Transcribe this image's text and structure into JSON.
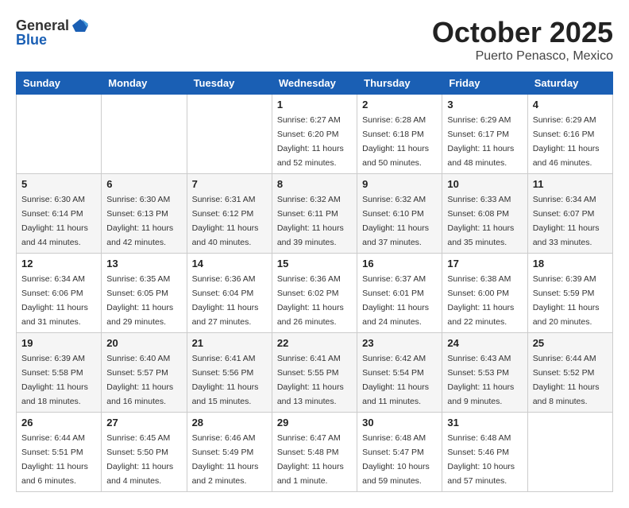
{
  "header": {
    "logo_general": "General",
    "logo_blue": "Blue",
    "month": "October 2025",
    "location": "Puerto Penasco, Mexico"
  },
  "weekdays": [
    "Sunday",
    "Monday",
    "Tuesday",
    "Wednesday",
    "Thursday",
    "Friday",
    "Saturday"
  ],
  "weeks": [
    [
      {
        "day": "",
        "sunrise": "",
        "sunset": "",
        "daylight": ""
      },
      {
        "day": "",
        "sunrise": "",
        "sunset": "",
        "daylight": ""
      },
      {
        "day": "",
        "sunrise": "",
        "sunset": "",
        "daylight": ""
      },
      {
        "day": "1",
        "sunrise": "Sunrise: 6:27 AM",
        "sunset": "Sunset: 6:20 PM",
        "daylight": "Daylight: 11 hours and 52 minutes."
      },
      {
        "day": "2",
        "sunrise": "Sunrise: 6:28 AM",
        "sunset": "Sunset: 6:18 PM",
        "daylight": "Daylight: 11 hours and 50 minutes."
      },
      {
        "day": "3",
        "sunrise": "Sunrise: 6:29 AM",
        "sunset": "Sunset: 6:17 PM",
        "daylight": "Daylight: 11 hours and 48 minutes."
      },
      {
        "day": "4",
        "sunrise": "Sunrise: 6:29 AM",
        "sunset": "Sunset: 6:16 PM",
        "daylight": "Daylight: 11 hours and 46 minutes."
      }
    ],
    [
      {
        "day": "5",
        "sunrise": "Sunrise: 6:30 AM",
        "sunset": "Sunset: 6:14 PM",
        "daylight": "Daylight: 11 hours and 44 minutes."
      },
      {
        "day": "6",
        "sunrise": "Sunrise: 6:30 AM",
        "sunset": "Sunset: 6:13 PM",
        "daylight": "Daylight: 11 hours and 42 minutes."
      },
      {
        "day": "7",
        "sunrise": "Sunrise: 6:31 AM",
        "sunset": "Sunset: 6:12 PM",
        "daylight": "Daylight: 11 hours and 40 minutes."
      },
      {
        "day": "8",
        "sunrise": "Sunrise: 6:32 AM",
        "sunset": "Sunset: 6:11 PM",
        "daylight": "Daylight: 11 hours and 39 minutes."
      },
      {
        "day": "9",
        "sunrise": "Sunrise: 6:32 AM",
        "sunset": "Sunset: 6:10 PM",
        "daylight": "Daylight: 11 hours and 37 minutes."
      },
      {
        "day": "10",
        "sunrise": "Sunrise: 6:33 AM",
        "sunset": "Sunset: 6:08 PM",
        "daylight": "Daylight: 11 hours and 35 minutes."
      },
      {
        "day": "11",
        "sunrise": "Sunrise: 6:34 AM",
        "sunset": "Sunset: 6:07 PM",
        "daylight": "Daylight: 11 hours and 33 minutes."
      }
    ],
    [
      {
        "day": "12",
        "sunrise": "Sunrise: 6:34 AM",
        "sunset": "Sunset: 6:06 PM",
        "daylight": "Daylight: 11 hours and 31 minutes."
      },
      {
        "day": "13",
        "sunrise": "Sunrise: 6:35 AM",
        "sunset": "Sunset: 6:05 PM",
        "daylight": "Daylight: 11 hours and 29 minutes."
      },
      {
        "day": "14",
        "sunrise": "Sunrise: 6:36 AM",
        "sunset": "Sunset: 6:04 PM",
        "daylight": "Daylight: 11 hours and 27 minutes."
      },
      {
        "day": "15",
        "sunrise": "Sunrise: 6:36 AM",
        "sunset": "Sunset: 6:02 PM",
        "daylight": "Daylight: 11 hours and 26 minutes."
      },
      {
        "day": "16",
        "sunrise": "Sunrise: 6:37 AM",
        "sunset": "Sunset: 6:01 PM",
        "daylight": "Daylight: 11 hours and 24 minutes."
      },
      {
        "day": "17",
        "sunrise": "Sunrise: 6:38 AM",
        "sunset": "Sunset: 6:00 PM",
        "daylight": "Daylight: 11 hours and 22 minutes."
      },
      {
        "day": "18",
        "sunrise": "Sunrise: 6:39 AM",
        "sunset": "Sunset: 5:59 PM",
        "daylight": "Daylight: 11 hours and 20 minutes."
      }
    ],
    [
      {
        "day": "19",
        "sunrise": "Sunrise: 6:39 AM",
        "sunset": "Sunset: 5:58 PM",
        "daylight": "Daylight: 11 hours and 18 minutes."
      },
      {
        "day": "20",
        "sunrise": "Sunrise: 6:40 AM",
        "sunset": "Sunset: 5:57 PM",
        "daylight": "Daylight: 11 hours and 16 minutes."
      },
      {
        "day": "21",
        "sunrise": "Sunrise: 6:41 AM",
        "sunset": "Sunset: 5:56 PM",
        "daylight": "Daylight: 11 hours and 15 minutes."
      },
      {
        "day": "22",
        "sunrise": "Sunrise: 6:41 AM",
        "sunset": "Sunset: 5:55 PM",
        "daylight": "Daylight: 11 hours and 13 minutes."
      },
      {
        "day": "23",
        "sunrise": "Sunrise: 6:42 AM",
        "sunset": "Sunset: 5:54 PM",
        "daylight": "Daylight: 11 hours and 11 minutes."
      },
      {
        "day": "24",
        "sunrise": "Sunrise: 6:43 AM",
        "sunset": "Sunset: 5:53 PM",
        "daylight": "Daylight: 11 hours and 9 minutes."
      },
      {
        "day": "25",
        "sunrise": "Sunrise: 6:44 AM",
        "sunset": "Sunset: 5:52 PM",
        "daylight": "Daylight: 11 hours and 8 minutes."
      }
    ],
    [
      {
        "day": "26",
        "sunrise": "Sunrise: 6:44 AM",
        "sunset": "Sunset: 5:51 PM",
        "daylight": "Daylight: 11 hours and 6 minutes."
      },
      {
        "day": "27",
        "sunrise": "Sunrise: 6:45 AM",
        "sunset": "Sunset: 5:50 PM",
        "daylight": "Daylight: 11 hours and 4 minutes."
      },
      {
        "day": "28",
        "sunrise": "Sunrise: 6:46 AM",
        "sunset": "Sunset: 5:49 PM",
        "daylight": "Daylight: 11 hours and 2 minutes."
      },
      {
        "day": "29",
        "sunrise": "Sunrise: 6:47 AM",
        "sunset": "Sunset: 5:48 PM",
        "daylight": "Daylight: 11 hours and 1 minute."
      },
      {
        "day": "30",
        "sunrise": "Sunrise: 6:48 AM",
        "sunset": "Sunset: 5:47 PM",
        "daylight": "Daylight: 10 hours and 59 minutes."
      },
      {
        "day": "31",
        "sunrise": "Sunrise: 6:48 AM",
        "sunset": "Sunset: 5:46 PM",
        "daylight": "Daylight: 10 hours and 57 minutes."
      },
      {
        "day": "",
        "sunrise": "",
        "sunset": "",
        "daylight": ""
      }
    ]
  ]
}
